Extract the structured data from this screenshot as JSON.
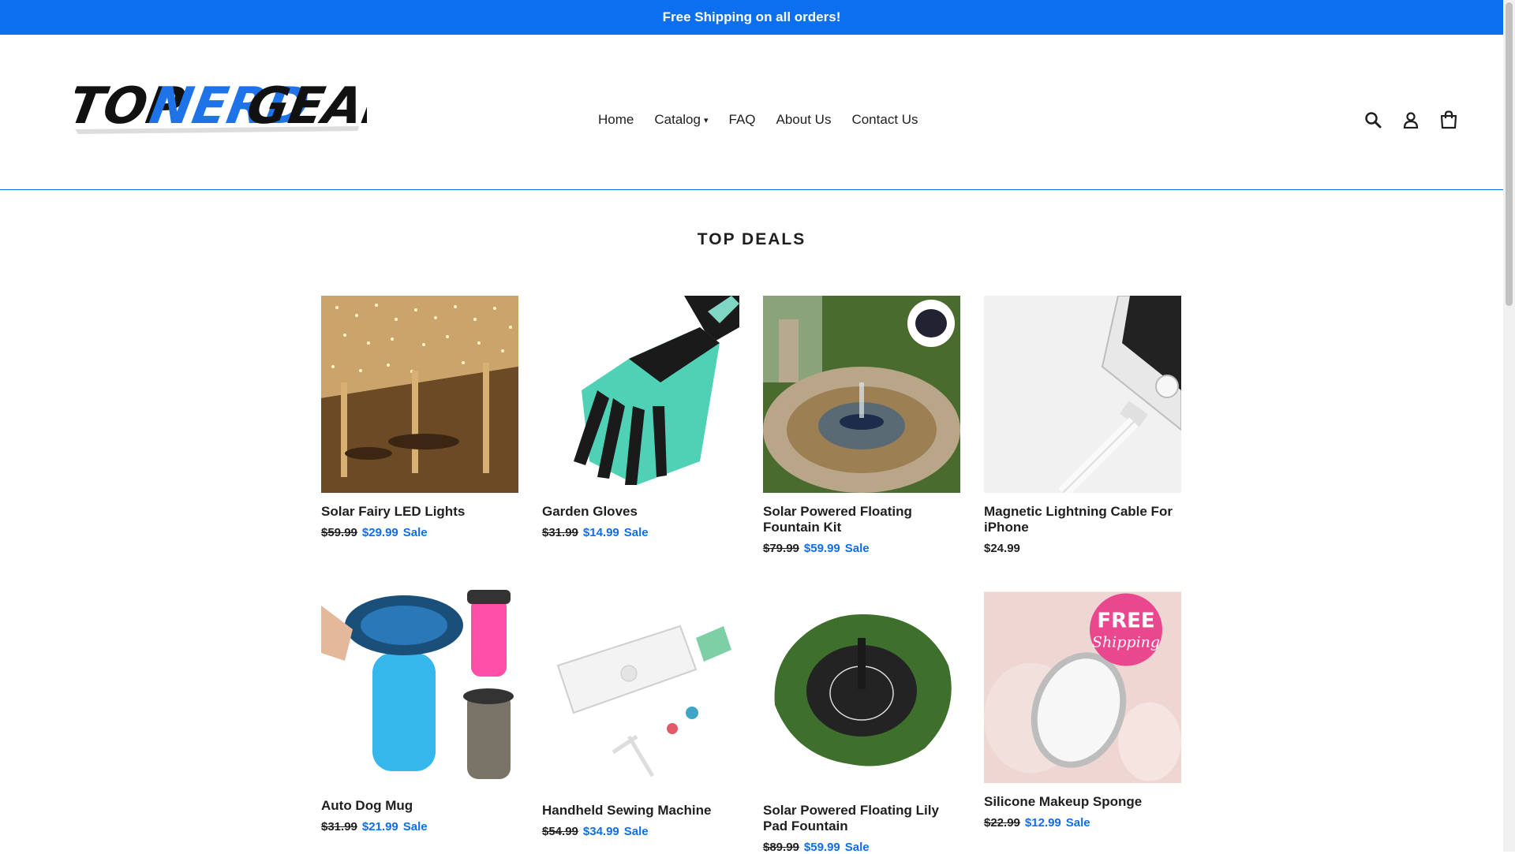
{
  "announcement": "Free Shipping on all orders!",
  "brand": {
    "part1": "TOP",
    "part2": "NERD",
    "part3": "GEAR"
  },
  "nav": {
    "home": "Home",
    "catalog": "Catalog",
    "faq": "FAQ",
    "about": "About Us",
    "contact": "Contact Us"
  },
  "section_title": "TOP DEALS",
  "products": [
    {
      "title": "Solar Fairy LED Lights",
      "old_price": "$59.99",
      "new_price": "$29.99",
      "sale": "Sale"
    },
    {
      "title": "Garden Gloves",
      "old_price": "$31.99",
      "new_price": "$14.99",
      "sale": "Sale"
    },
    {
      "title": "Solar Powered Floating Fountain Kit",
      "old_price": "$79.99",
      "new_price": "$59.99",
      "sale": "Sale"
    },
    {
      "title": "Magnetic Lightning Cable For iPhone",
      "price": "$24.99"
    },
    {
      "title": "Auto Dog Mug",
      "old_price": "$31.99",
      "new_price": "$21.99",
      "sale": "Sale"
    },
    {
      "title": "Handheld Sewing Machine",
      "old_price": "$54.99",
      "new_price": "$34.99",
      "sale": "Sale"
    },
    {
      "title": "Solar Powered Floating Lily Pad Fountain",
      "old_price": "$89.99",
      "new_price": "$59.99",
      "sale": "Sale"
    },
    {
      "title": "Silicone Makeup Sponge",
      "old_price": "$22.99",
      "new_price": "$12.99",
      "sale": "Sale",
      "badge_line1": "FREE",
      "badge_line2": "Shipping"
    }
  ],
  "colors": {
    "accent": "#0b6ff0",
    "text": "#1f1f1f"
  }
}
